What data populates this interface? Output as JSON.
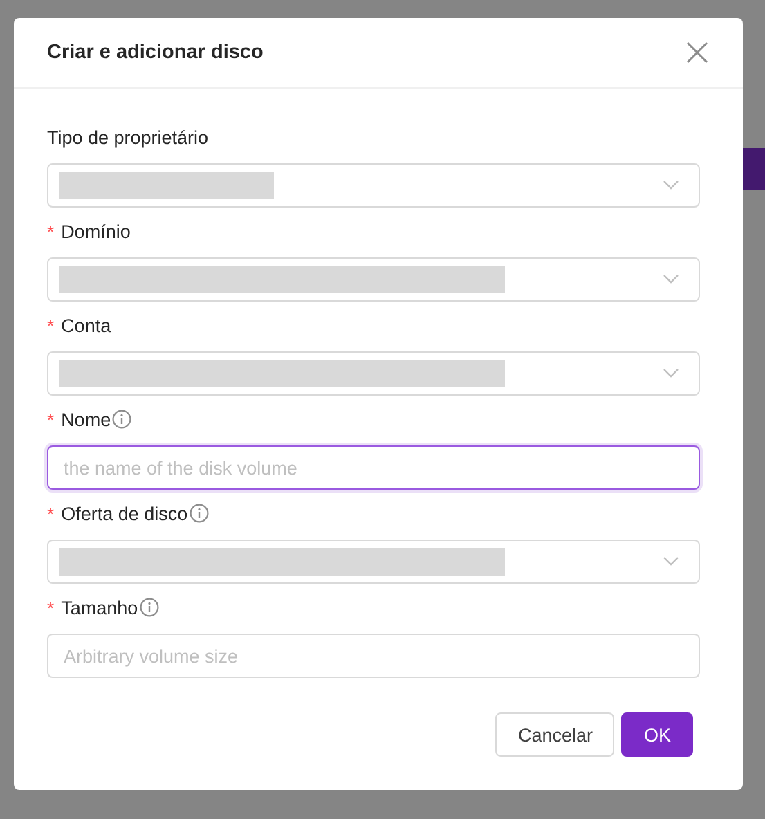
{
  "dialog": {
    "title": "Criar e adicionar disco"
  },
  "fields": [
    {
      "kind": "select",
      "label": "Tipo de proprietário",
      "info": false
    },
    {
      "kind": "select",
      "mark": "*",
      "label": "Domínio",
      "info": false
    },
    {
      "kind": "select",
      "mark": "*",
      "label": "Conta",
      "info": false
    },
    {
      "kind": "input",
      "mark": "*",
      "label": "Nome",
      "info": true,
      "placeholder": "the name of the disk volume",
      "focused": true
    },
    {
      "kind": "select",
      "mark": "*",
      "label": "Oferta de disco",
      "info": true
    },
    {
      "kind": "input",
      "mark": "*",
      "label": "Tamanho",
      "info": true,
      "placeholder": "Arbitrary volume size",
      "focused": false
    }
  ],
  "buttons": [
    {
      "kind": "default",
      "label": "Cancelar"
    },
    {
      "kind": "primary",
      "label": "OK"
    }
  ]
}
